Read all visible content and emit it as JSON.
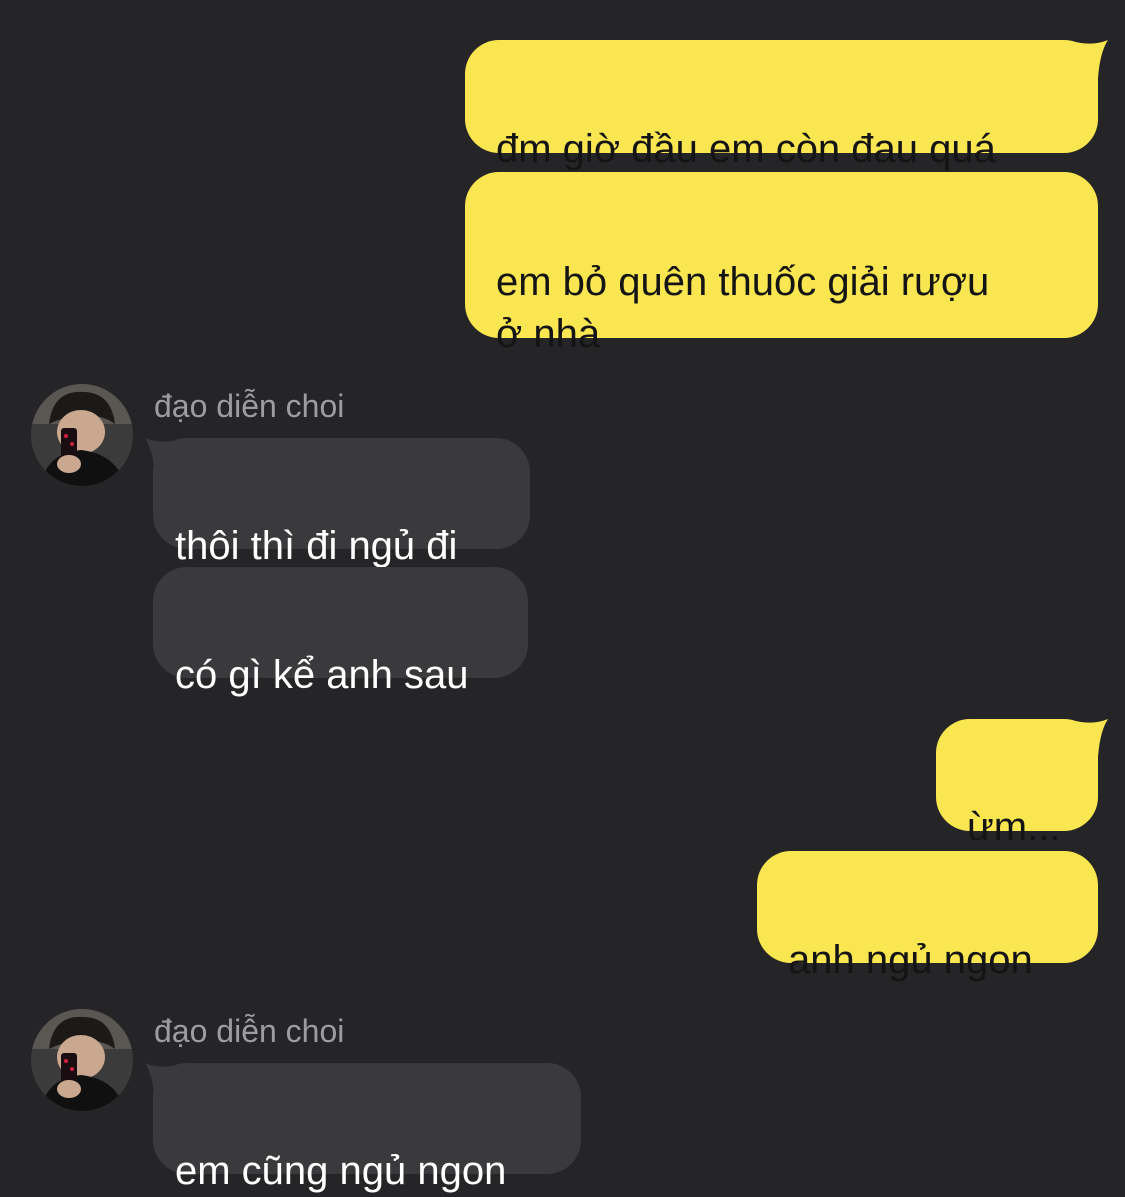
{
  "chat": {
    "messages": [
      {
        "direction": "outgoing",
        "text": "đm giờ đầu em còn đau quá"
      },
      {
        "direction": "outgoing",
        "text": "em bỏ quên thuốc giải rượu\nở nhà"
      },
      {
        "direction": "incoming",
        "sender": "đạo diễn choi",
        "text": "thôi thì đi ngủ đi"
      },
      {
        "direction": "incoming",
        "text": "có gì kể anh sau"
      },
      {
        "direction": "outgoing",
        "text": "ừm..."
      },
      {
        "direction": "outgoing",
        "text": "anh ngủ ngon"
      },
      {
        "direction": "incoming",
        "sender": "đạo diễn choi",
        "text": "em cũng ngủ ngon"
      }
    ]
  },
  "colors": {
    "background": "#252527",
    "outgoing_bubble": "#f9e650",
    "incoming_bubble": "#3a3a3c",
    "sender_name": "#9d9da0"
  }
}
